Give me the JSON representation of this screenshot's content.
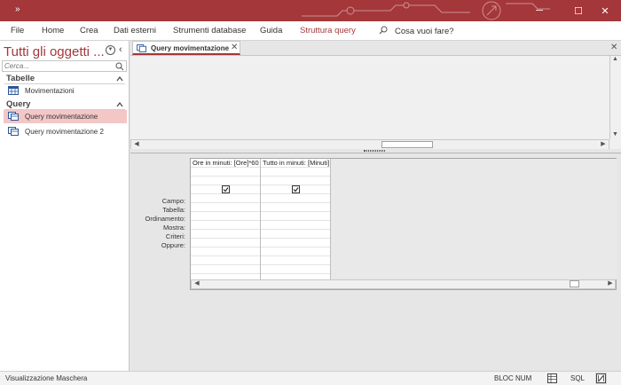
{
  "titlebar": {
    "quick_access": "»",
    "minimize": "─",
    "maximize": "☐",
    "close": "✕"
  },
  "ribbon": {
    "tabs": [
      "File",
      "Home",
      "Crea",
      "Dati esterni",
      "Strumenti database",
      "Guida",
      "Struttura query"
    ],
    "tell_me": "Cosa vuoi fare?"
  },
  "nav": {
    "title": "Tutti gli oggetti ...",
    "search_placeholder": "Cerca...",
    "groups": [
      {
        "label": "Tabelle",
        "items": [
          "Movimentazioni"
        ]
      },
      {
        "label": "Query",
        "items": [
          "Query movimentazione",
          "Query movimentazione 2"
        ]
      }
    ],
    "selected_item": "Query movimentazione"
  },
  "document": {
    "tab_label": "Query movimentazione",
    "close_x": "✕"
  },
  "design_grid": {
    "row_labels": [
      "Campo:",
      "Tabella:",
      "Ordinamento:",
      "Mostra:",
      "Criteri:",
      "Oppure:"
    ],
    "columns": [
      {
        "campo": "Ore in minuti: [Ore]*60",
        "mostra": true
      },
      {
        "campo": "Tutto in minuti: [Minuti]",
        "mostra": true
      }
    ]
  },
  "statusbar": {
    "left_text": "Visualizzazione Maschera",
    "bloc_num": "BLOC NUM",
    "sql": "SQL"
  },
  "colors": {
    "accent": "#a4373a",
    "selection": "#f4c7c7"
  }
}
